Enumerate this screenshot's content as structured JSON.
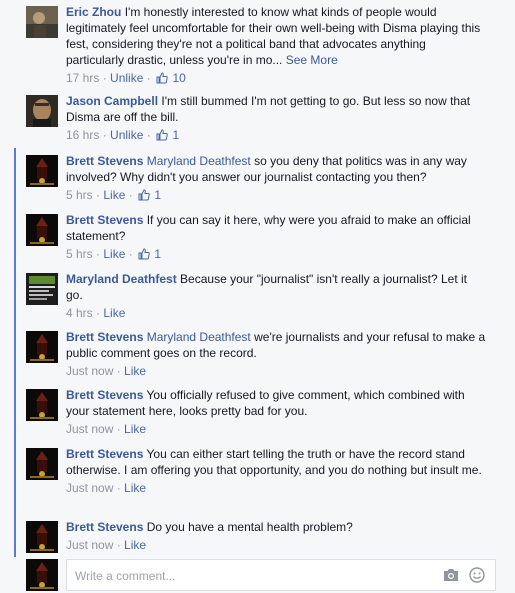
{
  "comments": [
    {
      "author": "Eric Zhou",
      "tag": "",
      "text": "I'm honestly interested to know what kinds of people would legitimately feel uncomfortable for their own well-being with Disma playing this fest, considering they're not a political band that advocates anything particularly drastic, unless you're in mo...",
      "see_more": "See More",
      "time": "17 hrs",
      "action": "Unlike",
      "likes": "10"
    },
    {
      "author": "Jason Campbell",
      "tag": "",
      "text": "I'm still bummed I'm not getting to go. But less so now that Disma are off the bill.",
      "time": "16 hrs",
      "action": "Unlike",
      "likes": "1"
    },
    {
      "author": "Brett Stevens",
      "tag": "Maryland Deathfest",
      "text": "so you deny that politics was in any way involved? Why didn't you answer our journalist contacting you then?",
      "time": "5 hrs",
      "action": "Like",
      "likes": "1"
    },
    {
      "author": "Brett Stevens",
      "tag": "",
      "text": "If you can say it here, why were you afraid to make an official statement?",
      "time": "5 hrs",
      "action": "Like",
      "likes": "1"
    },
    {
      "author": "Maryland Deathfest",
      "tag": "",
      "text": "Because your \"journalist\" isn't really a journalist? Let it go.",
      "time": "4 hrs",
      "action": "Like",
      "likes": ""
    },
    {
      "author": "Brett Stevens",
      "tag": "Maryland Deathfest",
      "text": "we're journalists and your refusal to make a public comment goes on the record.",
      "time": "Just now",
      "action": "Like",
      "likes": ""
    },
    {
      "author": "Brett Stevens",
      "tag": "",
      "text": "You officially refused to give comment, which combined with your statement here, looks pretty bad for you.",
      "time": "Just now",
      "action": "Like",
      "likes": ""
    },
    {
      "author": "Brett Stevens",
      "tag": "",
      "text": "You can either start telling the truth or have the record stand otherwise. I am offering you that opportunity, and you do nothing but insult me.",
      "time": "Just now",
      "action": "Like",
      "likes": ""
    },
    {
      "author": "Brett Stevens",
      "tag": "",
      "text": "Do you have a mental health problem?",
      "time": "Just now",
      "action": "Like",
      "likes": ""
    }
  ],
  "composer": {
    "placeholder": "Write a comment..."
  },
  "separator": "·",
  "icons": {
    "like": "thumbs-up-icon",
    "camera": "camera-icon",
    "emoji": "smiley-icon"
  },
  "colors": {
    "link": "#3b5998",
    "meta": "#90949c",
    "thread_line": "#5b7bd5"
  }
}
